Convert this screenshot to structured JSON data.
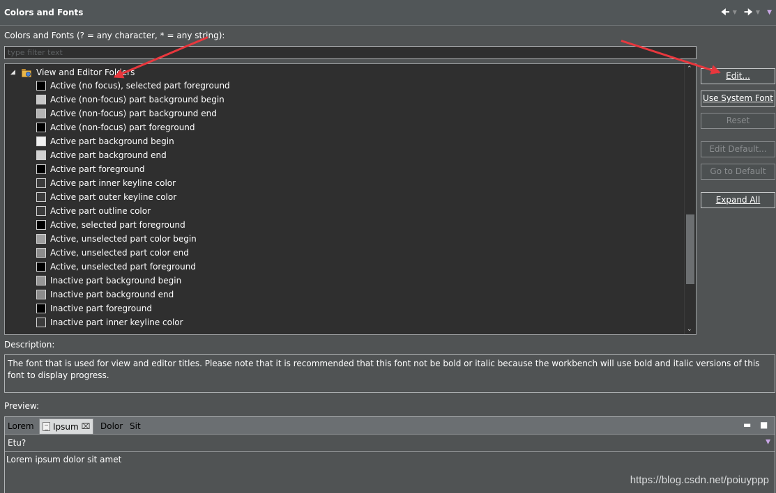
{
  "header": {
    "title": "Colors and Fonts",
    "back_icon": "arrow-left-icon",
    "forward_icon": "arrow-right-icon",
    "menu_icon": "view-menu-icon"
  },
  "filter": {
    "label": "Colors and Fonts (? = any character, * = any string):",
    "placeholder": "type filter text"
  },
  "tree": {
    "root_label": "View and Editor Folders",
    "items": [
      {
        "label": "Active (no focus), selected part foreground",
        "swatch": "#000000"
      },
      {
        "label": "Active (non-focus) part background begin",
        "swatch": "#c8c8c8"
      },
      {
        "label": "Active (non-focus) part background end",
        "swatch": "#b4b4b4"
      },
      {
        "label": "Active (non-focus) part foreground",
        "swatch": "#000000"
      },
      {
        "label": "Active part background begin",
        "swatch": "#f0f0f0"
      },
      {
        "label": "Active part background end",
        "swatch": "#d2d2d2"
      },
      {
        "label": "Active part foreground",
        "swatch": "#000000"
      },
      {
        "label": "Active part inner keyline color",
        "swatch": "#3c3c3c"
      },
      {
        "label": "Active part outer keyline color",
        "swatch": "#3c3c3c"
      },
      {
        "label": "Active part outline color",
        "swatch": "#3c3c3c"
      },
      {
        "label": "Active, selected part foreground",
        "swatch": "#000000"
      },
      {
        "label": "Active, unselected part color begin",
        "swatch": "#a0a0a0"
      },
      {
        "label": "Active, unselected part color end",
        "swatch": "#8c8c8c"
      },
      {
        "label": "Active, unselected part foreground",
        "swatch": "#000000"
      },
      {
        "label": "Inactive part background begin",
        "swatch": "#969696"
      },
      {
        "label": "Inactive part background end",
        "swatch": "#8c8c8c"
      },
      {
        "label": "Inactive part foreground",
        "swatch": "#000000"
      },
      {
        "label": "Inactive part inner keyline color",
        "swatch": "#3c3c3c"
      }
    ]
  },
  "buttons": {
    "edit": "Edit...",
    "use_system_font": "Use System Font",
    "reset": "Reset",
    "edit_default": "Edit Default...",
    "go_to_default": "Go to Default",
    "expand_all": "Expand All"
  },
  "description": {
    "label": "Description:",
    "text": "The font that is used for view and editor titles.  Please note that it is recommended that this font not be bold or italic because the workbench will use bold and italic versions of this font to display progress."
  },
  "preview": {
    "label": "Preview:",
    "tabs": [
      "Lorem",
      "Ipsum",
      "Dolor",
      "Sit"
    ],
    "combo_value": "Etu?",
    "text": "Lorem ipsum dolor sit amet"
  },
  "watermark": "https://blog.csdn.net/poiuyppp",
  "colors": {
    "background": "#505354",
    "tree_background": "#2f2f2f",
    "annotation_arrow": "#e8373d"
  }
}
